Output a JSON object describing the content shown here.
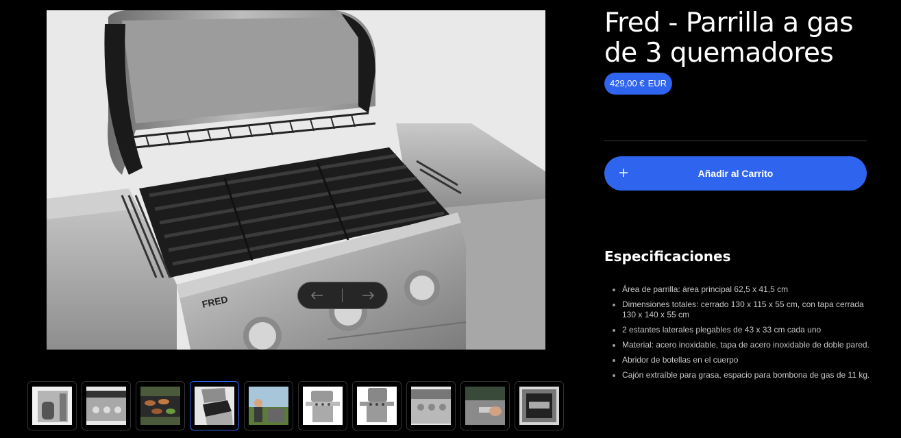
{
  "product": {
    "title": "Fred - Parrilla a gas de 3 quemadores",
    "price": "429,00 €",
    "currency": "EUR",
    "add_to_cart_label": "Añadir al Carrito",
    "main_image_brand_text": "FRED"
  },
  "gallery": {
    "prev_icon": "arrow-left-icon",
    "next_icon": "arrow-right-icon",
    "active_index": 3,
    "thumbnail_count": 10
  },
  "specs": {
    "title": "Especificaciones",
    "items": [
      "Área de parrilla: área principal 62,5 x 41,5 cm",
      "Dimensiones totales: cerrado 130 x 115 x 55 cm, con tapa cerrada 130 x 140 x 55 cm",
      "2 estantes laterales plegables de 43 x 33 cm cada uno",
      "Material: acero inoxidable, tapa de acero inoxidable de doble pared.",
      "Abridor de botellas en el cuerpo",
      "Cajón extraíble para grasa, espacio para bombona de gas de 11 kg."
    ]
  },
  "colors": {
    "accent": "#2f64ef",
    "background": "#000000"
  }
}
